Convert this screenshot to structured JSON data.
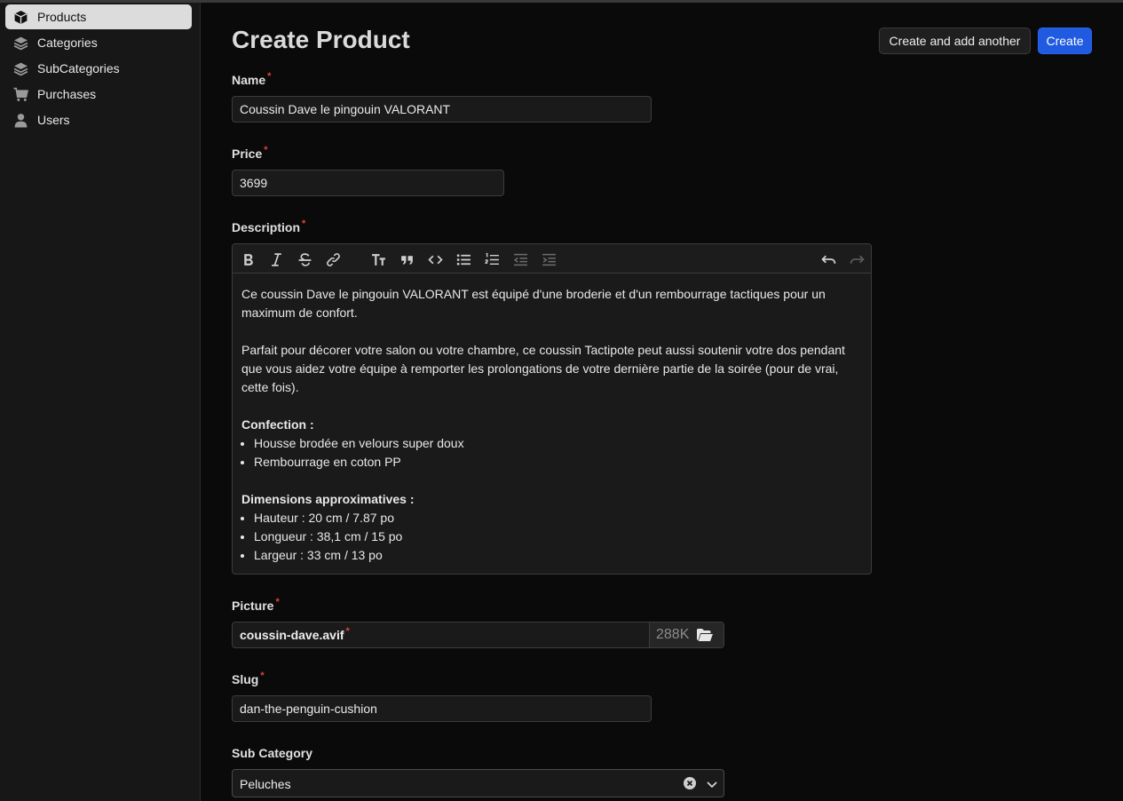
{
  "sidebar": {
    "items": [
      {
        "label": "Products",
        "icon": "cube-icon",
        "active": true
      },
      {
        "label": "Categories",
        "icon": "layers-icon",
        "active": false
      },
      {
        "label": "SubCategories",
        "icon": "layers-icon",
        "active": false
      },
      {
        "label": "Purchases",
        "icon": "cart-icon",
        "active": false
      },
      {
        "label": "Users",
        "icon": "user-icon",
        "active": false
      }
    ]
  },
  "header": {
    "title": "Create Product",
    "create_another_label": "Create and add another",
    "create_label": "Create"
  },
  "form": {
    "name": {
      "label": "Name",
      "required": "*",
      "value": "Coussin Dave le pingouin VALORANT"
    },
    "price": {
      "label": "Price",
      "required": "*",
      "value": "3699"
    },
    "description": {
      "label": "Description",
      "required": "*",
      "toolbar": [
        "bold-icon",
        "italic-icon",
        "strikethrough-icon",
        "link-icon",
        "heading-icon",
        "quote-icon",
        "code-icon",
        "bullet-list-icon",
        "numbered-list-icon",
        "outdent-icon",
        "indent-icon",
        "undo-icon",
        "redo-icon"
      ],
      "para1": "Ce coussin Dave le pingouin VALORANT est équipé d'une broderie et d'un rembourrage tactiques pour un maximum de confort.",
      "para2": "Parfait pour décorer votre salon ou votre chambre, ce coussin Tactipote peut aussi soutenir votre dos pendant que vous aidez votre équipe à remporter les prolongations de votre dernière partie de la soirée (pour de vrai, cette fois).",
      "confection_title": "Confection :",
      "confection_items": [
        "Housse brodée en velours super doux",
        "Rembourrage en coton PP"
      ],
      "dimensions_title": "Dimensions approximatives :",
      "dimension_items": [
        "Hauteur : 20 cm / 7.87 po",
        "Longueur : 38,1 cm / 15 po",
        "Largeur : 33 cm / 13 po"
      ]
    },
    "picture": {
      "label": "Picture",
      "required": "*",
      "filename": "coussin-dave.avif",
      "size": "288K"
    },
    "slug": {
      "label": "Slug",
      "required": "*",
      "value": "dan-the-penguin-cushion"
    },
    "sub_category": {
      "label": "Sub Category",
      "value": "Peluches"
    }
  },
  "colors": {
    "primary": "#1f5ae0",
    "required": "#e0443b",
    "background": "#0a0a0a",
    "sidebar": "#171717"
  }
}
